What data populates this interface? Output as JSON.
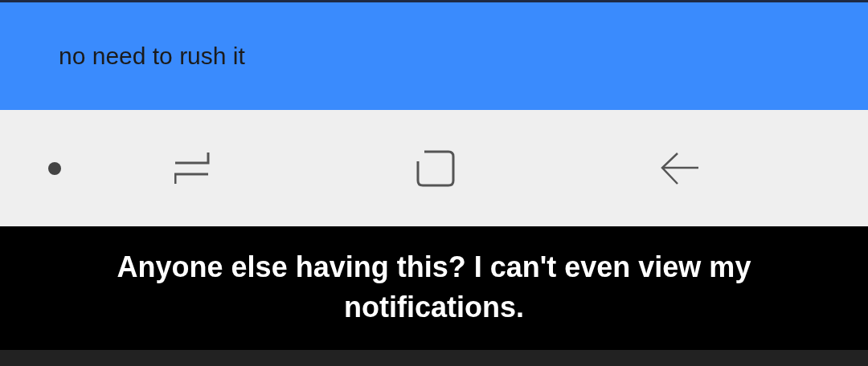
{
  "message": {
    "text": "no need to rush it"
  },
  "nav_bar": {
    "buttons": [
      {
        "kind": "dot"
      },
      {
        "kind": "recents"
      },
      {
        "kind": "home"
      },
      {
        "kind": "back"
      }
    ]
  },
  "caption": {
    "text": "Anyone else having this? I can't even view my notifications."
  }
}
